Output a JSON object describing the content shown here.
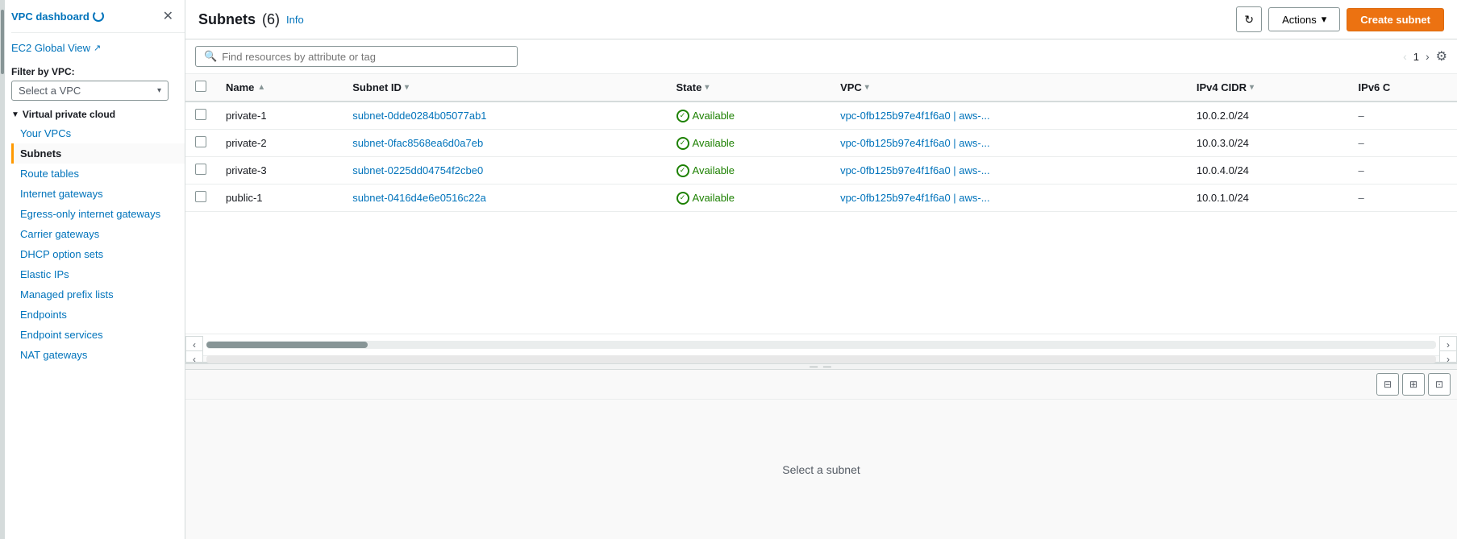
{
  "sidebar": {
    "title": "VPC dashboard",
    "ec2_global_view": "EC2 Global View",
    "filter_label": "Filter by VPC:",
    "vpc_select_placeholder": "Select a VPC",
    "category_vpc": "Virtual private cloud",
    "nav_items": [
      {
        "id": "your-vpcs",
        "label": "Your VPCs",
        "active": false
      },
      {
        "id": "subnets",
        "label": "Subnets",
        "active": true
      },
      {
        "id": "route-tables",
        "label": "Route tables",
        "active": false
      },
      {
        "id": "internet-gateways",
        "label": "Internet gateways",
        "active": false
      },
      {
        "id": "egress-gateways",
        "label": "Egress-only internet gateways",
        "active": false
      },
      {
        "id": "carrier-gateways",
        "label": "Carrier gateways",
        "active": false
      },
      {
        "id": "dhcp-option-sets",
        "label": "DHCP option sets",
        "active": false
      },
      {
        "id": "elastic-ips",
        "label": "Elastic IPs",
        "active": false
      },
      {
        "id": "managed-prefix-lists",
        "label": "Managed prefix lists",
        "active": false
      },
      {
        "id": "endpoints",
        "label": "Endpoints",
        "active": false
      },
      {
        "id": "endpoint-services",
        "label": "Endpoint services",
        "active": false
      },
      {
        "id": "nat-gateways",
        "label": "NAT gateways",
        "active": false
      }
    ]
  },
  "header": {
    "title": "Subnets",
    "count": "(6)",
    "info_label": "Info",
    "refresh_icon": "↻",
    "actions_label": "Actions",
    "create_label": "Create subnet"
  },
  "search": {
    "placeholder": "Find resources by attribute or tag"
  },
  "pagination": {
    "page": "1",
    "prev_disabled": true,
    "next_disabled": false
  },
  "table": {
    "columns": [
      {
        "id": "name",
        "label": "Name",
        "sort": "asc"
      },
      {
        "id": "subnet-id",
        "label": "Subnet ID",
        "sort": "desc"
      },
      {
        "id": "state",
        "label": "State",
        "sort": "none"
      },
      {
        "id": "vpc",
        "label": "VPC",
        "sort": "none"
      },
      {
        "id": "ipv4-cidr",
        "label": "IPv4 CIDR",
        "sort": "none"
      },
      {
        "id": "ipv6-cidr",
        "label": "IPv6 C",
        "sort": "none"
      }
    ],
    "rows": [
      {
        "name": "private-1",
        "subnet_id": "subnet-0dde0284b05077ab1",
        "state": "Available",
        "vpc": "vpc-0fb125b97e4f1f6a0 | aws-...",
        "ipv4_cidr": "10.0.2.0/24",
        "ipv6_cidr": "–"
      },
      {
        "name": "private-2",
        "subnet_id": "subnet-0fac8568ea6d0a7eb",
        "state": "Available",
        "vpc": "vpc-0fb125b97e4f1f6a0 | aws-...",
        "ipv4_cidr": "10.0.3.0/24",
        "ipv6_cidr": "–"
      },
      {
        "name": "private-3",
        "subnet_id": "subnet-0225dd04754f2cbe0",
        "state": "Available",
        "vpc": "vpc-0fb125b97e4f1f6a0 | aws-...",
        "ipv4_cidr": "10.0.4.0/24",
        "ipv6_cidr": "–"
      },
      {
        "name": "public-1",
        "subnet_id": "subnet-0416d4e6e0516c22a",
        "state": "Available",
        "vpc": "vpc-0fb125b97e4f1f6a0 | aws-...",
        "ipv4_cidr": "10.0.1.0/24",
        "ipv6_cidr": "–"
      }
    ]
  },
  "detail": {
    "select_message": "Select a subnet"
  },
  "colors": {
    "accent": "#ec7211",
    "link": "#0073bb",
    "available": "#1d8102"
  }
}
